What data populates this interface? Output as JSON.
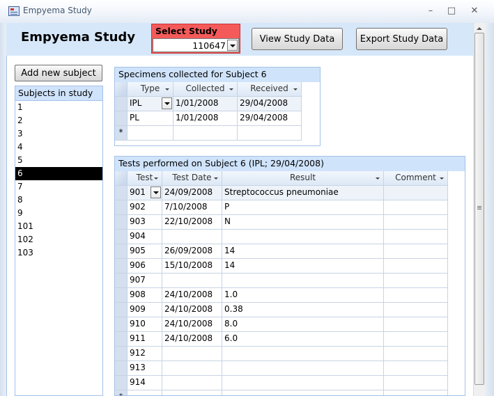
{
  "window": {
    "title": "Empyema Study",
    "icon": "access-form-icon"
  },
  "header": {
    "title": "Empyema Study",
    "select_study_label": "Select Study",
    "select_study_value": "110647",
    "view_button": "View Study Data",
    "export_button": "Export Study Data"
  },
  "left": {
    "add_button": "Add new subject",
    "subjects_header": "Subjects in study",
    "subjects": [
      "1",
      "2",
      "3",
      "4",
      "5",
      "6",
      "7",
      "8",
      "9",
      "101",
      "102",
      "103"
    ],
    "selected_index": 5
  },
  "specimens": {
    "title": "Specimens collected for Subject 6",
    "columns": [
      "Type",
      "Collected",
      "Received"
    ],
    "rows": [
      [
        "IPL",
        "1/01/2008",
        "29/04/2008"
      ],
      [
        "PL",
        "1/01/2008",
        "29/04/2008"
      ]
    ],
    "new_row_marker": "*"
  },
  "tests": {
    "title": "Tests performed on Subject 6 (IPL; 29/04/2008)",
    "columns": [
      "Test",
      "Test Date",
      "Result",
      "Comment"
    ],
    "rows": [
      [
        "901",
        "24/09/2008",
        "Streptococcus pneumoniae",
        ""
      ],
      [
        "902",
        "7/10/2008",
        "P",
        ""
      ],
      [
        "903",
        "22/10/2008",
        "N",
        ""
      ],
      [
        "904",
        "",
        "",
        ""
      ],
      [
        "905",
        "26/09/2008",
        "14",
        ""
      ],
      [
        "906",
        "15/10/2008",
        "14",
        ""
      ],
      [
        "907",
        "",
        "",
        ""
      ],
      [
        "908",
        "24/10/2008",
        "1.0",
        ""
      ],
      [
        "909",
        "24/10/2008",
        "0.38",
        ""
      ],
      [
        "910",
        "24/10/2008",
        "8.0",
        ""
      ],
      [
        "911",
        "24/10/2008",
        "6.0",
        ""
      ],
      [
        "912",
        "",
        "",
        ""
      ],
      [
        "913",
        "",
        "",
        ""
      ],
      [
        "914",
        "",
        "",
        ""
      ]
    ],
    "new_row_marker": "*"
  },
  "colors": {
    "band": "#d6e7f9",
    "select_study_bg": "#f45a5a",
    "section_header": "#cfe3fb",
    "selected_subject_bg": "#000000"
  }
}
